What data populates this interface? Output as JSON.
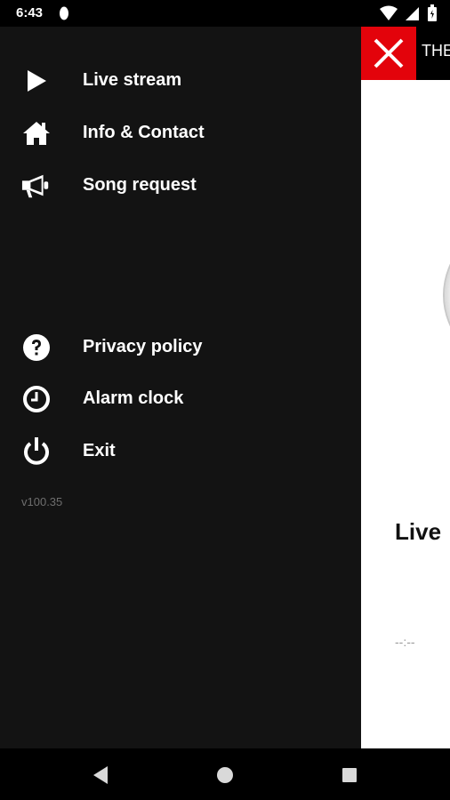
{
  "status_bar": {
    "time": "6:43",
    "icons": [
      "notification-dot-icon",
      "wifi-icon",
      "signal-icon",
      "battery-icon"
    ]
  },
  "drawer": {
    "items": [
      {
        "label": "Live stream",
        "icon": "play-icon"
      },
      {
        "label": "Info & Contact",
        "icon": "home-icon"
      },
      {
        "label": "Song request",
        "icon": "megaphone-icon"
      },
      {
        "label": "Privacy policy",
        "icon": "help-icon"
      },
      {
        "label": "Alarm clock",
        "icon": "clock-icon"
      },
      {
        "label": "Exit",
        "icon": "power-icon"
      }
    ],
    "version": "v100.35"
  },
  "app": {
    "header_title": "THE",
    "live_heading": "Live",
    "time_readout": "--:--",
    "accent": "#e3030b"
  },
  "navbar": {
    "icons": [
      "back-icon",
      "home-circle-icon",
      "recents-icon"
    ]
  }
}
